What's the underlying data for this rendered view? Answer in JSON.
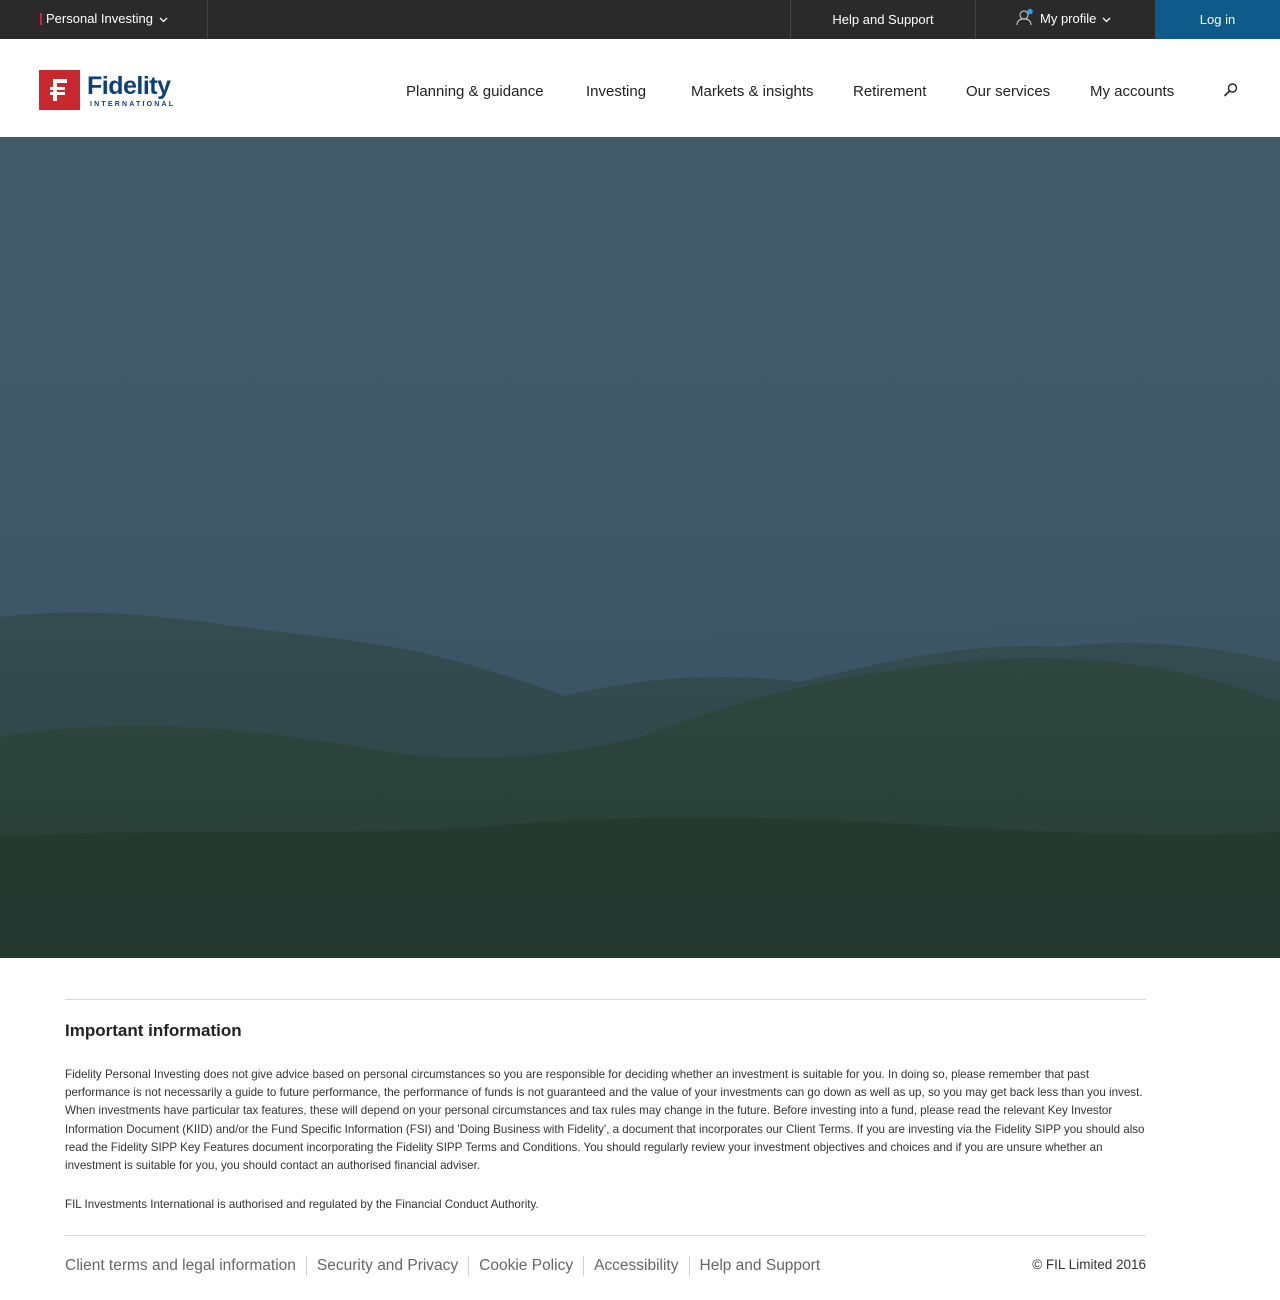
{
  "utility_bar": {
    "region_label": "Personal Investing",
    "help_label": "Help and Support",
    "profile_label": "My profile",
    "login_label": "Log in"
  },
  "header": {
    "logo_word": "Fidelity",
    "logo_sub": "INTERNATIONAL",
    "nav": [
      "Planning & guidance",
      "Investing",
      "Markets & insights",
      "Retirement",
      "Our services",
      "My accounts"
    ]
  },
  "important_info": {
    "title": "Important information",
    "body": "Fidelity Personal Investing does not give advice based on personal circumstances so you are responsible for deciding whether an investment is suitable for you. In doing so, please remember that past performance is not necessarily a guide to future performance, the performance of funds is not guaranteed and the value of your investments can go down as well as up, so you may get back less than you invest. When investments have particular tax features, these will depend on your personal circumstances and tax rules may change in the future. Before investing into a fund, please read the relevant Key Investor Information Document (KIID) and/or the Fund Specific Information (FSI) and 'Doing Business with Fidelity', a document that incorporates our Client Terms. If you are investing via the Fidelity SIPP you should also read the Fidelity SIPP Key Features document incorporating the Fidelity SIPP Terms and Conditions. You should regularly review your investment objectives and choices and if you are unsure whether an investment is suitable for you, you should contact an authorised financial adviser.",
    "regulation": "FIL Investments International is authorised and regulated by the Financial Conduct Authority."
  },
  "footer": {
    "links": [
      "Client terms and legal information",
      "Security and Privacy",
      "Cookie Policy",
      "Accessibility",
      "Help and Support"
    ],
    "copyright": "© FIL Limited 2016"
  },
  "colors": {
    "utility_bar_bg": "#2a2a2a",
    "login_bg": "#0e5a8a",
    "brand_red": "#c8282d",
    "brand_blue": "#0e3f7d"
  }
}
